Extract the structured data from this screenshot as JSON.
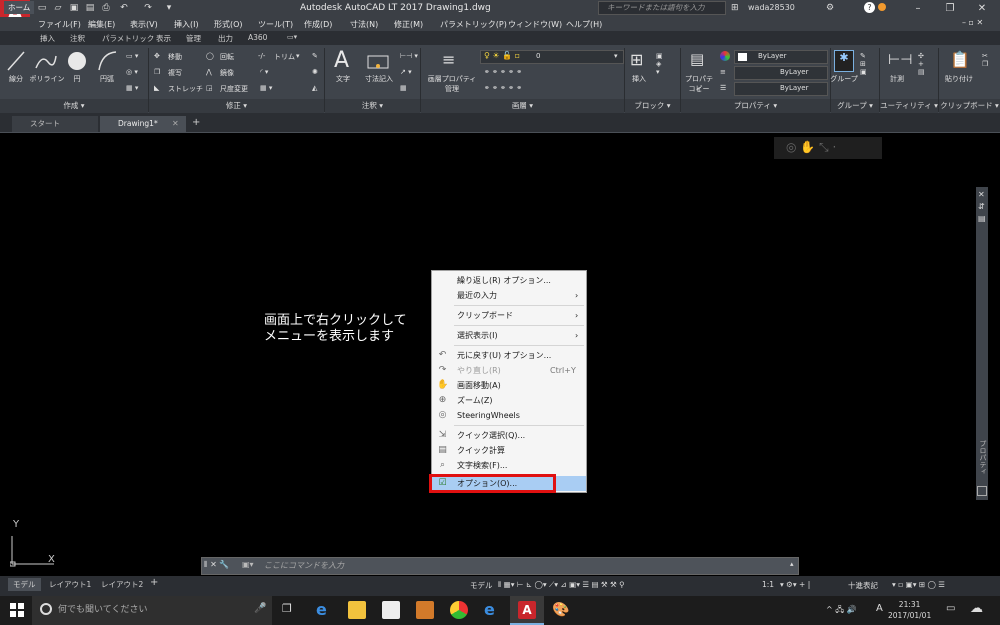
{
  "window": {
    "title": "Autodesk AutoCAD LT 2017   Drawing1.dwg",
    "search_placeholder": "キーワードまたは語句を入力",
    "user": "wada28530"
  },
  "menubar": [
    "ファイル(F)",
    "編集(E)",
    "表示(V)",
    "挿入(I)",
    "形式(O)",
    "ツール(T)",
    "作成(D)",
    "寸法(N)",
    "修正(M)",
    "パラメトリック(P)",
    "ウィンドウ(W)",
    "ヘルプ(H)"
  ],
  "ribbon_tabs": [
    "ホーム",
    "挿入",
    "注釈",
    "パラメトリック",
    "表示",
    "管理",
    "出力",
    "A360"
  ],
  "ribbon": {
    "draw": {
      "line": "線分",
      "polyline": "ポリライン",
      "circle": "円",
      "arc": "円弧",
      "footer": "作成"
    },
    "modify": {
      "move": "移動",
      "rotate": "回転",
      "trim": "トリム",
      "copy": "複写",
      "mirror": "鏡像",
      "stretch": "ストレッチ",
      "scale": "尺度変更",
      "footer": "修正"
    },
    "annotation": {
      "text": "文字",
      "dimension": "寸法記入",
      "footer": "注釈"
    },
    "layers": {
      "layer_props_1": "画層プロパティ",
      "layer_props_2": "管理",
      "current_layer": "0",
      "footer": "画層"
    },
    "block": {
      "insert": "挿入",
      "footer": "ブロック"
    },
    "properties": {
      "match_1": "プロパティ",
      "match_2": "コピー",
      "color": "ByLayer",
      "linetype": "ByLayer",
      "lineweight": "ByLayer",
      "footer": "プロパティ"
    },
    "groups": {
      "group": "グループ",
      "footer": "グループ"
    },
    "utilities": {
      "measure": "計測",
      "footer": "ユーティリティ"
    },
    "clipboard": {
      "paste": "貼り付け",
      "footer": "クリップボード"
    }
  },
  "file_tabs": {
    "start": "スタート",
    "drawing": "Drawing1*"
  },
  "annotation": {
    "line1": "画面上で右クリックして",
    "line2": "メニューを表示します"
  },
  "context_menu": {
    "items": [
      {
        "label": "繰り返し(R) オプション..."
      },
      {
        "label": "最近の入力",
        "arrow": "›"
      },
      {
        "label": "クリップボード",
        "arrow": "›"
      },
      {
        "label": "選択表示(I)",
        "arrow": "›"
      },
      {
        "label": "元に戻す(U) オプション..."
      },
      {
        "label": "やり直し(R)",
        "shortcut": "Ctrl+Y"
      },
      {
        "label": "画面移動(A)"
      },
      {
        "label": "ズーム(Z)"
      },
      {
        "label": "SteeringWheels"
      },
      {
        "label": "クイック選択(Q)..."
      },
      {
        "label": "クイック計算"
      },
      {
        "label": "文字検索(F)..."
      },
      {
        "label": "オプション(O)..."
      }
    ]
  },
  "palette_label": "プロパティ",
  "command_line": {
    "placeholder": "ここにコマンドを入力"
  },
  "layout_tabs": [
    "モデル",
    "レイアウト1",
    "レイアウト2"
  ],
  "statusbar": {
    "model": "モデル",
    "scale": "1:1",
    "units": "十進表記"
  },
  "taskbar": {
    "search": "何でも聞いてください",
    "time": "21:31",
    "date": "2017/01/01",
    "ime": "A"
  },
  "colors": {
    "accent_red": "#c9262c",
    "highlight_box": "#e01010",
    "menu_highlight": "#a9cdf3"
  }
}
